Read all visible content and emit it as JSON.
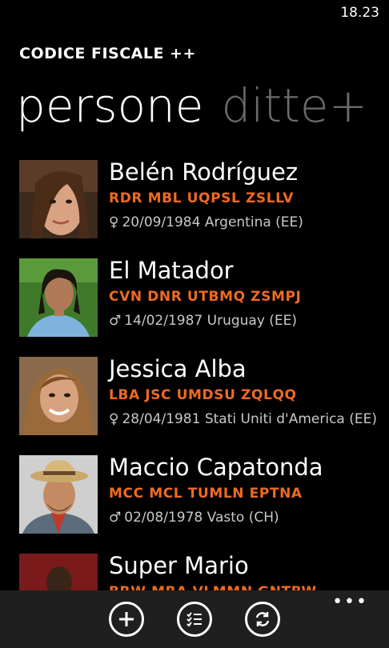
{
  "status": {
    "time": "18.23"
  },
  "app": {
    "title": "CODICE FISCALE ++"
  },
  "pivot": {
    "active": "persone",
    "inactive": "ditte+"
  },
  "people": [
    {
      "name": "Belén Rodríguez",
      "code": "RDR MBL UQPSL ZSLLV",
      "gender": "♀",
      "info": "20/09/1984 Argentina (EE)"
    },
    {
      "name": "El Matador",
      "code": "CVN DNR UTBMQ ZSMPJ",
      "gender": "♂",
      "info": "14/02/1987 Uruguay (EE)"
    },
    {
      "name": "Jessica Alba",
      "code": "LBA JSC UMDSU ZQLQQ",
      "gender": "♀",
      "info": "28/04/1981 Stati Uniti d'America (EE)"
    },
    {
      "name": "Maccio Capatonda",
      "code": "MCC MCL TUMLN EPTNA",
      "gender": "♂",
      "info": "02/08/1978 Vasto (CH)"
    },
    {
      "name": "Super Mario",
      "code": "BRW MRA VLMMN GNTBW",
      "gender": "♂",
      "info": ""
    }
  ],
  "appbar": {
    "more": "•••"
  },
  "icons": {
    "add": "add-icon",
    "list": "list-icon",
    "sync": "sync-icon"
  }
}
